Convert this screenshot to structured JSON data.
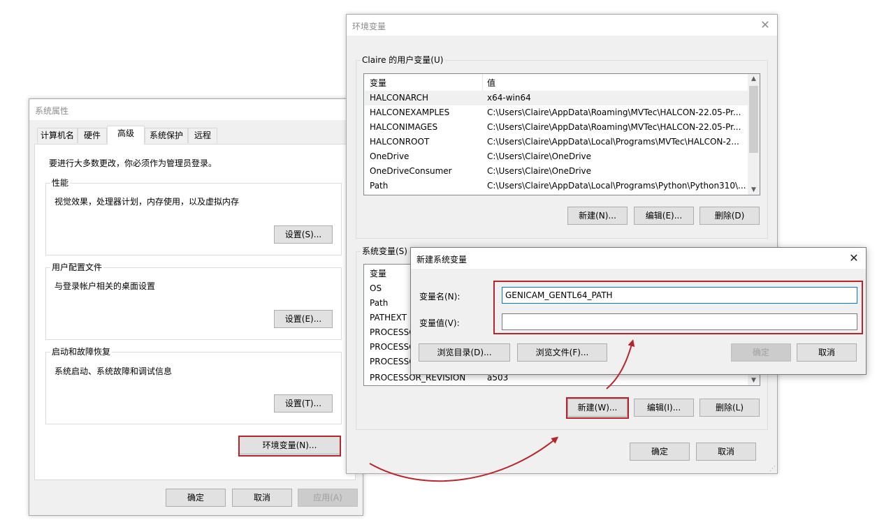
{
  "system_properties": {
    "title": "系统属性",
    "tabs": [
      {
        "label": "计算机名"
      },
      {
        "label": "硬件"
      },
      {
        "label": "高级"
      },
      {
        "label": "系统保护"
      },
      {
        "label": "远程"
      }
    ],
    "admin_note": "要进行大多数更改，你必须作为管理员登录。",
    "performance": {
      "label": "性能",
      "desc": "视觉效果，处理器计划，内存使用，以及虚拟内存",
      "button": "设置(S)..."
    },
    "user_profiles": {
      "label": "用户配置文件",
      "desc": "与登录帐户相关的桌面设置",
      "button": "设置(E)..."
    },
    "startup_recovery": {
      "label": "启动和故障恢复",
      "desc": "系统启动、系统故障和调试信息",
      "button": "设置(T)..."
    },
    "env_button": "环境变量(N)...",
    "ok": "确定",
    "cancel": "取消",
    "apply": "应用(A)"
  },
  "env_vars": {
    "title": "环境变量",
    "user_group_label": "Claire 的用户变量(U)",
    "headers": {
      "name": "变量",
      "value": "值"
    },
    "user_vars": [
      {
        "name": "HALCONARCH",
        "value": "x64-win64"
      },
      {
        "name": "HALCONEXAMPLES",
        "value": "C:\\Users\\Claire\\AppData\\Roaming\\MVTec\\HALCON-22.05-Pr..."
      },
      {
        "name": "HALCONIMAGES",
        "value": "C:\\Users\\Claire\\AppData\\Roaming\\MVTec\\HALCON-22.05-Pr..."
      },
      {
        "name": "HALCONROOT",
        "value": "C:\\Users\\Claire\\AppData\\Local\\Programs\\MVTec\\HALCON-2..."
      },
      {
        "name": "OneDrive",
        "value": "C:\\Users\\Claire\\OneDrive"
      },
      {
        "name": "OneDriveConsumer",
        "value": "C:\\Users\\Claire\\OneDrive"
      },
      {
        "name": "Path",
        "value": "C:\\Users\\Claire\\AppData\\Local\\Programs\\Python\\Python310\\..."
      }
    ],
    "user_buttons": {
      "new": "新建(N)...",
      "edit": "编辑(E)...",
      "delete": "删除(D)"
    },
    "system_group_label": "系统变量(S)",
    "system_vars": [
      {
        "name": "OS",
        "value": ""
      },
      {
        "name": "Path",
        "value": ""
      },
      {
        "name": "PATHEXT",
        "value": ""
      },
      {
        "name": "PROCESSO",
        "value": ""
      },
      {
        "name": "PROCESSO",
        "value": ""
      },
      {
        "name": "PROCESSO",
        "value": ""
      },
      {
        "name": "PROCESSOR_REVISION",
        "value": "a503"
      }
    ],
    "system_buttons": {
      "new": "新建(W)...",
      "edit": "编辑(I)...",
      "delete": "删除(L)"
    },
    "ok": "确定",
    "cancel": "取消"
  },
  "new_sys_var": {
    "title": "新建系统变量",
    "name_label": "变量名(N):",
    "value_label": "变量值(V):",
    "name_value": "GENICAM_GENTL64_PATH",
    "value_value": "",
    "browse_dir": "浏览目录(D)...",
    "browse_file": "浏览文件(F)...",
    "ok": "确定",
    "cancel": "取消"
  },
  "colors": {
    "highlight": "#b8242a",
    "selected_row": "#f0f0f0"
  }
}
